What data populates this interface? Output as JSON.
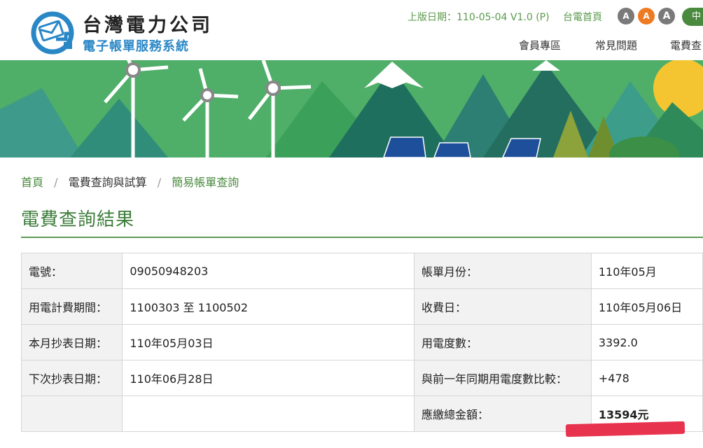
{
  "header": {
    "logo_title": "台灣電力公司",
    "logo_subtitle": "電子帳單服務系統",
    "version_text": "上版日期：110-05-04 V1.0 (P)",
    "home_link": "台電首頁",
    "font_sizes": [
      "A",
      "A",
      "A"
    ],
    "font_colors": [
      "#7a7a7a",
      "#ee7b22",
      "#7a7a7a"
    ],
    "lang": "中"
  },
  "nav": [
    "會員專區",
    "常見問題",
    "電費查"
  ],
  "breadcrumb": {
    "home": "首頁",
    "level2": "電費查詢與試算",
    "current": "簡易帳單查詢"
  },
  "page_title": "電費查詢結果",
  "rows": [
    {
      "l1": "電號：",
      "v1": "09050948203",
      "l2": "帳單月份：",
      "v2": "110年05月"
    },
    {
      "l1": "用電計費期間：",
      "v1": "1100303 至 1100502",
      "l2": "收費日：",
      "v2": "110年05月06日"
    },
    {
      "l1": "本月抄表日期：",
      "v1": "110年05月03日",
      "l2": "用電度數：",
      "v2": "3392.0"
    },
    {
      "l1": "下次抄表日期：",
      "v1": "110年06月28日",
      "l2": "與前一年同期用電度數比較：",
      "v2": "+478"
    },
    {
      "l1": "",
      "v1": "",
      "l2": "應繳總金額：",
      "v2": "13594元"
    }
  ],
  "colors": {
    "accent_green": "#3d7d3a",
    "highlight_red": "#e8334f"
  }
}
